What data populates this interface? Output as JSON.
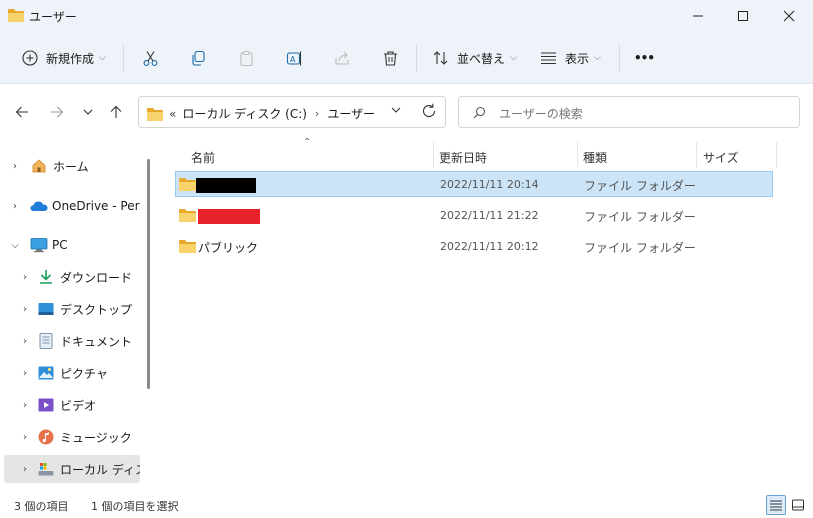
{
  "window": {
    "title": "ユーザー",
    "controls": {
      "minimize_icon": "minimize-icon",
      "maximize_icon": "maximize-icon",
      "close_icon": "close-icon"
    }
  },
  "toolbar": {
    "new_label": "新規作成",
    "sort_label": "並べ替え",
    "view_label": "表示",
    "more_label": "•••",
    "icons": [
      "plus-circle-icon",
      "cut-icon",
      "copy-icon",
      "paste-icon",
      "rename-icon",
      "share-icon",
      "delete-icon",
      "sort-icon",
      "view-icon",
      "more-icon"
    ]
  },
  "address": {
    "overflow": "«",
    "segments": [
      "ローカル ディスク (C:)",
      "ユーザー"
    ],
    "separator": "›"
  },
  "search": {
    "placeholder": "ユーザーの検索"
  },
  "sidebar": {
    "items": [
      {
        "label": "ホーム",
        "icon": "home-icon"
      },
      {
        "label": "OneDrive - Personal",
        "icon": "cloud-icon"
      },
      {
        "label": "PC",
        "icon": "pc-icon"
      },
      {
        "label": "ダウンロード",
        "icon": "download-icon"
      },
      {
        "label": "デスクトップ",
        "icon": "desktop-icon"
      },
      {
        "label": "ドキュメント",
        "icon": "document-icon"
      },
      {
        "label": "ピクチャ",
        "icon": "pictures-icon"
      },
      {
        "label": "ビデオ",
        "icon": "video-icon"
      },
      {
        "label": "ミュージック",
        "icon": "music-icon"
      },
      {
        "label": "ローカル ディスク (C:)",
        "icon": "drive-icon"
      }
    ]
  },
  "columns": {
    "name": "名前",
    "date": "更新日時",
    "type": "種類",
    "size": "サイズ"
  },
  "files": [
    {
      "name": "",
      "date": "2022/11/11 20:14",
      "type": "ファイル フォルダー",
      "redaction_color": "#000000"
    },
    {
      "name": "",
      "date": "2022/11/11 21:22",
      "type": "ファイル フォルダー",
      "redaction_color": "#e8222b"
    },
    {
      "name": "パブリック",
      "date": "2022/11/11 20:12",
      "type": "ファイル フォルダー"
    }
  ],
  "status": {
    "count": "3 個の項目",
    "selected": "1 個の項目を選択"
  },
  "colors": {
    "accent": "#0067c0",
    "selection": "#cce4f7",
    "folder": "#f2c14e"
  }
}
